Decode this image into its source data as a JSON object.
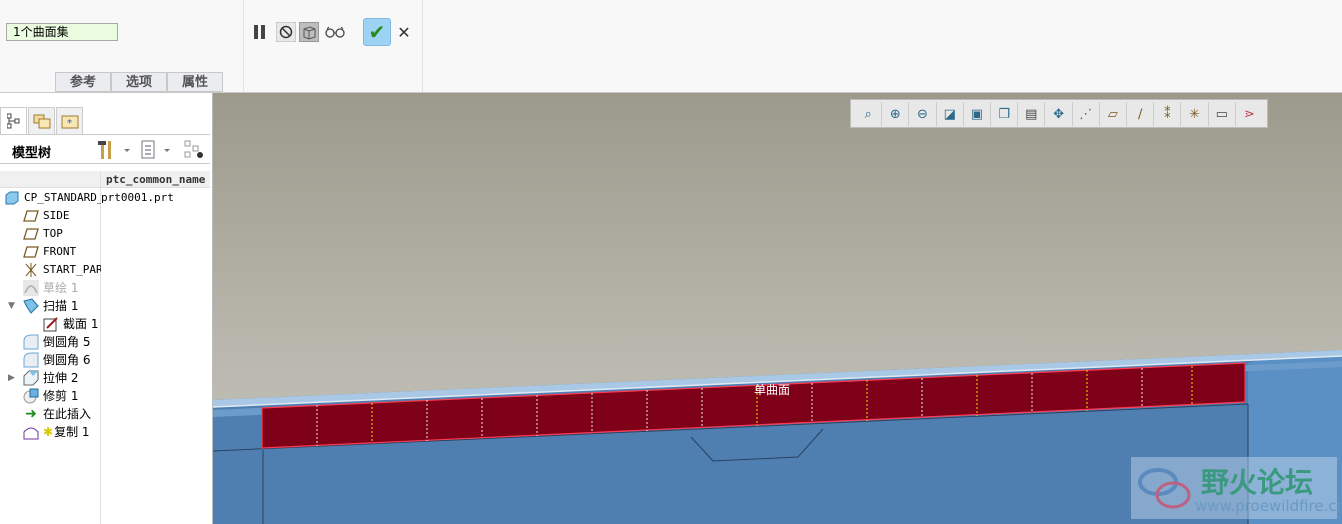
{
  "ribbon": {
    "collector": "1个曲面集",
    "tabs": [
      "参考",
      "选项",
      "属性"
    ],
    "pause": "pause-icon",
    "no_preview": "no-preview-icon",
    "preview": "preview-icon",
    "glasses": "verify-icon",
    "ok": "✔",
    "cancel": "✕"
  },
  "panel": {
    "tabs": [
      "model-tree-icon",
      "folder-browser-icon",
      "favorites-icon"
    ],
    "title": "模型树",
    "column": "ptc_common_name",
    "items": [
      {
        "label": "CP_STANDARD_F",
        "value": "prt0001.prt",
        "icon": "part-icon"
      },
      {
        "label": "SIDE",
        "icon": "datum-plane-icon"
      },
      {
        "label": "TOP",
        "icon": "datum-plane-icon"
      },
      {
        "label": "FRONT",
        "icon": "datum-plane-icon"
      },
      {
        "label": "START_PART",
        "icon": "csys-icon"
      },
      {
        "label": "草绘 1",
        "icon": "sketch-icon"
      },
      {
        "label": "扫描 1",
        "icon": "sweep-icon"
      },
      {
        "label": "截面 1",
        "icon": "section-icon"
      },
      {
        "label": "倒圆角 5",
        "icon": "round-icon"
      },
      {
        "label": "倒圆角 6",
        "icon": "round-icon"
      },
      {
        "label": "拉伸 2",
        "icon": "extrude-icon"
      },
      {
        "label": "修剪 1",
        "icon": "trim-icon"
      },
      {
        "label": "在此插入",
        "icon": "insert-here-icon"
      },
      {
        "label": "复制 1",
        "icon": "copy-icon"
      }
    ]
  },
  "viewport": {
    "label": "单曲面",
    "toolbar": [
      "refit",
      "zoom-in",
      "zoom-out",
      "repaint",
      "display-style",
      "saved-views",
      "view-manager",
      "spin-center",
      "datum-display",
      "plane-display",
      "axis-display",
      "point-display",
      "csys-display",
      "annotation-display",
      "appearance"
    ]
  },
  "watermark": {
    "title": "野火论坛",
    "url": "www.proewildfire.cn"
  }
}
